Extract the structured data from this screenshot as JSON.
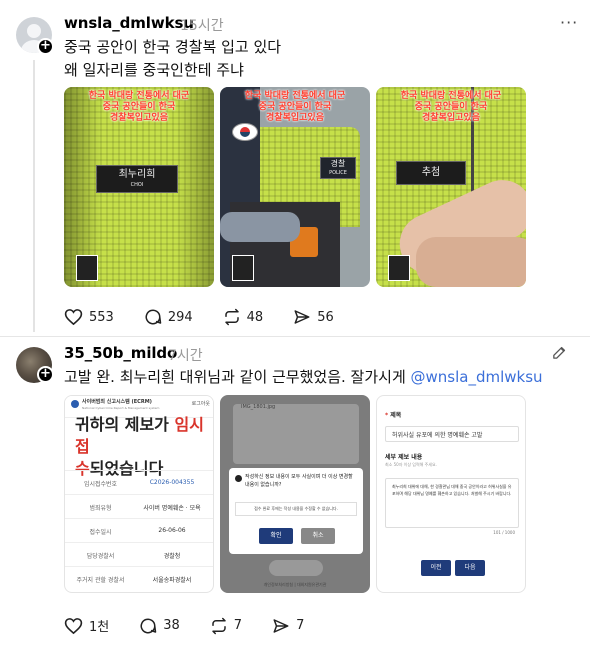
{
  "post1": {
    "username": "wnsla_dmlwksu",
    "time": "15시간",
    "more": "···",
    "lines": [
      "중국 공안이 한국 경찰복 입고 있다",
      "왜 일자리를 중국인한테 주냐"
    ],
    "images": [
      {
        "banner": "한국 박대랑 전통에서 대군\n중국 공안들이 한국\n경찰복입고있음",
        "patch": "최누리희",
        "patch_sub": "CHOI"
      },
      {
        "banner": "한국 박대랑 전통에서 대군\n중국 공안들이 한국\n경찰복입고있음",
        "patch": "경찰",
        "patch_sub": "POLICE"
      },
      {
        "banner": "한국 박대랑 전통에서 대군\n중국 공안들이 한국\n경찰복입고있음",
        "patch": "추첨",
        "patch_sub": ""
      }
    ],
    "actions": {
      "likes": "553",
      "comments": "294",
      "reposts": "48",
      "shares": "56"
    }
  },
  "post2": {
    "username": "35_50b_mildo",
    "time": "7시간",
    "text": "고발 완. 최누리흰 대위님과 같이 근무했었음. 잘가시게 ",
    "mention": "@wnsla_dmlwksu",
    "doc1": {
      "header": "사이버범죄 신고시스템 (ECRM)",
      "header_sub": "National Cybercrime Report & Management system",
      "header_right": "로그아웃",
      "title_plain": "귀하의 제보가 ",
      "title_red": "임시 접",
      "title_line2_red": "수",
      "title_line2": "되었습니다",
      "rows": [
        {
          "k": "임시접수번호",
          "v": "C2026-004355"
        },
        {
          "k": "범죄유형",
          "v": "사이버 명예훼손 · 모욕"
        },
        {
          "k": "접수일시",
          "v": "26-06-06"
        },
        {
          "k": "담당경찰서",
          "v": "경찰청"
        },
        {
          "k": "주거지 관할 경찰서",
          "v": "서울송파경찰서"
        }
      ]
    },
    "doc2": {
      "file": "IMG_1801.jpg",
      "msg": "작성하신 정보 내용이 모두 사실이며 더 이상 변경할 내용이 없습니까?",
      "sub": "접수 완료 후에는 작성 내용을 수정할 수 없습니다.",
      "confirm": "확인",
      "cancel": "취소",
      "footer": "개인정보처리방침 | 대외지원유관기관"
    },
    "doc3": {
      "title_label": "제목",
      "title_value": "허위사실 유포에 의한 명예훼손 고발",
      "content_label": "세부 제보 내용",
      "content_hint": "최소 50자 이상 입력해 주세요.",
      "content_value": "최누리희 대위에 대해, 한 경찰관님 대해 중국 공안이라고 허위사실을 유포하며 해당 대위님 명예를 훼손하고 있습니다. 처벌해 주시기 바랍니다.",
      "counter": "101 / 1000",
      "prev": "이전",
      "next": "다음"
    },
    "actions": {
      "likes": "1천",
      "comments": "38",
      "reposts": "7",
      "shares": "7"
    }
  }
}
